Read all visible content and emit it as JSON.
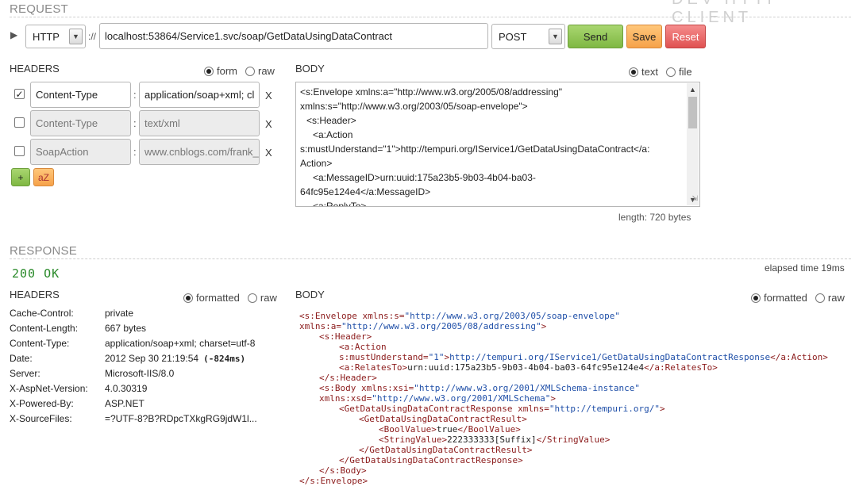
{
  "app": {
    "brand": "DEV HTTP CLIENT"
  },
  "request": {
    "section_title": "REQUEST",
    "protocol": "HTTP",
    "scheme_sep": "://",
    "url": "localhost:53864/Service1.svc/soap/GetDataUsingDataContract",
    "method": "POST",
    "send_label": "Send",
    "save_label": "Save",
    "reset_label": "Reset",
    "headers": {
      "title": "HEADERS",
      "mode_form": "form",
      "mode_raw": "raw",
      "rows": [
        {
          "checked": true,
          "name": "Content-Type",
          "value": "application/soap+xml; cl",
          "delete": "X"
        },
        {
          "checked": false,
          "name": "Content-Type",
          "value": "text/xml",
          "delete": "X"
        },
        {
          "checked": false,
          "name": "SoapAction",
          "value": "www.cnblogs.com/frank_",
          "delete": "X"
        }
      ],
      "add_label": "+",
      "sort_label": "aZ"
    },
    "body": {
      "title": "BODY",
      "mode_text": "text",
      "mode_file": "file",
      "lines": [
        "<s:Envelope xmlns:a=\"http://www.w3.org/2005/08/addressing\"",
        "xmlns:s=\"http://www.w3.org/2003/05/soap-envelope\">",
        "  <s:Header>",
        "    <a:Action",
        "s:mustUnderstand=\"1\">http://tempuri.org/IService1/GetDataUsingDataContract</a:",
        "Action>",
        "    <a:MessageID>urn:uuid:175a23b5-9b03-4b04-ba03-",
        "64fc95e124e4</a:MessageID>",
        "    <a:ReplyTo>"
      ],
      "length_text": "length: 720 bytes"
    }
  },
  "response": {
    "section_title": "RESPONSE",
    "status": "200 OK",
    "elapsed": "elapsed time 19ms",
    "headers": {
      "title": "HEADERS",
      "mode_formatted": "formatted",
      "mode_raw": "raw",
      "rows": [
        {
          "name": "Cache-Control:",
          "value": "private",
          "extra": ""
        },
        {
          "name": "Content-Length:",
          "value": "667 bytes",
          "extra": ""
        },
        {
          "name": "Content-Type:",
          "value": "application/soap+xml; charset=utf-8",
          "extra": ""
        },
        {
          "name": "Date:",
          "value": "2012 Sep 30 21:19:54",
          "extra": "(-824ms)"
        },
        {
          "name": "Server:",
          "value": "Microsoft-IIS/8.0",
          "extra": ""
        },
        {
          "name": "X-AspNet-Version:",
          "value": "4.0.30319",
          "extra": ""
        },
        {
          "name": "X-Powered-By:",
          "value": "ASP.NET",
          "extra": ""
        },
        {
          "name": "X-SourceFiles:",
          "value": "=?UTF-8?B?RDpcTXkgRG9jdW1l...",
          "extra": ""
        }
      ]
    },
    "body": {
      "title": "BODY",
      "mode_formatted": "formatted",
      "mode_raw": "raw",
      "xml": {
        "l1a": "<s:Envelope xmlns:s=",
        "l1v": "\"http://www.w3.org/2003/05/soap-envelope\"",
        "l2a": "xmlns:a=",
        "l2v": "\"http://www.w3.org/2005/08/addressing\"",
        "l2b": ">",
        "l3": "<s:Header>",
        "l4": "<a:Action",
        "l5a": "s:mustUnderstand=",
        "l5v": "\"1\"",
        "l5b": ">",
        "l5t": "http://tempuri.org/IService1/GetDataUsingDataContractResponse",
        "l5c": "</a:Action>",
        "l6a": "<a:RelatesTo>",
        "l6t": "urn:uuid:175a23b5-9b03-4b04-ba03-64fc95e124e4",
        "l6b": "</a:RelatesTo>",
        "l7": "</s:Header>",
        "l8a": "<s:Body xmlns:xsi=",
        "l8v": "\"http://www.w3.org/2001/XMLSchema-instance\"",
        "l9a": "xmlns:xsd=",
        "l9v": "\"http://www.w3.org/2001/XMLSchema\"",
        "l9b": ">",
        "l10a": "<GetDataUsingDataContractResponse xmlns=",
        "l10v": "\"http://tempuri.org/\"",
        "l10b": ">",
        "l11": "<GetDataUsingDataContractResult>",
        "l12a": "<BoolValue>",
        "l12t": "true",
        "l12b": "</BoolValue>",
        "l13a": "<StringValue>",
        "l13t": "222333333[Suffix]",
        "l13b": "</StringValue>",
        "l14": "</GetDataUsingDataContractResult>",
        "l15": "</GetDataUsingDataContractResponse>",
        "l16": "</s:Body>",
        "l17": "</s:Envelope>"
      }
    }
  }
}
